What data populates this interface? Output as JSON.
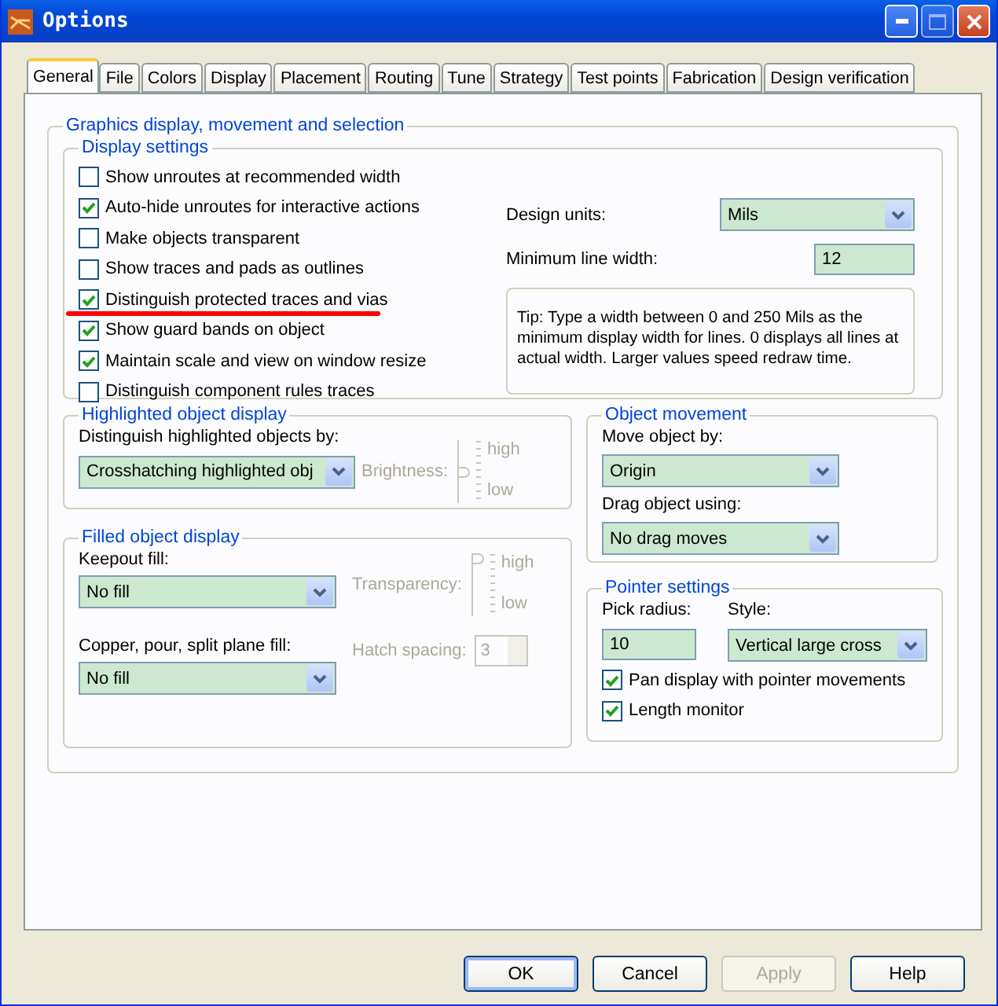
{
  "window": {
    "title": "Options"
  },
  "tabs": [
    {
      "label": "General",
      "selected": true
    },
    {
      "label": "File",
      "selected": false
    },
    {
      "label": "Colors",
      "selected": false
    },
    {
      "label": "Display",
      "selected": false
    },
    {
      "label": "Placement",
      "selected": false
    },
    {
      "label": "Routing",
      "selected": false
    },
    {
      "label": "Tune",
      "selected": false
    },
    {
      "label": "Strategy",
      "selected": false
    },
    {
      "label": "Test points",
      "selected": false
    },
    {
      "label": "Fabrication",
      "selected": false
    },
    {
      "label": "Design verification",
      "selected": false
    }
  ],
  "group": {
    "title": "Graphics display, movement and selection"
  },
  "display_settings": {
    "title": "Display settings",
    "checkboxes": [
      {
        "label": "Show unroutes at recommended width",
        "checked": false
      },
      {
        "label": "Auto-hide unroutes for interactive actions",
        "checked": true
      },
      {
        "label": "Make objects transparent",
        "checked": false
      },
      {
        "label": "Show traces and pads as outlines",
        "checked": false
      },
      {
        "label": "Distinguish protected traces and vias",
        "checked": true,
        "underlined": true
      },
      {
        "label": "Show guard bands on object",
        "checked": true
      },
      {
        "label": "Maintain scale and view on window resize",
        "checked": true
      },
      {
        "label": "Distinguish component rules traces",
        "checked": false
      }
    ],
    "design_units": {
      "label": "Design units:",
      "value": "Mils"
    },
    "min_line_width": {
      "label": "Minimum line width:",
      "value": "12"
    },
    "tip": "Tip: Type a width between 0 and 250 Mils as the minimum display width for lines. 0 displays all lines at actual width. Larger values speed redraw time."
  },
  "highlighted": {
    "title": "Highlighted object display",
    "select": {
      "label": "Distinguish highlighted objects by:",
      "value": "Crosshatching highlighted obj"
    },
    "brightness": {
      "label": "Brightness:",
      "high": "high",
      "low": "low",
      "level": 0.5,
      "disabled": true
    }
  },
  "filled": {
    "title": "Filled object display",
    "keepout": {
      "label": "Keepout fill:",
      "value": "No fill"
    },
    "copper": {
      "label": "Copper, pour, split plane fill:",
      "value": "No fill"
    },
    "transparency": {
      "label": "Transparency:",
      "high": "high",
      "low": "low",
      "level": 1,
      "disabled": true
    },
    "hatch": {
      "label": "Hatch spacing:",
      "value": "3",
      "disabled": true
    }
  },
  "object_movement": {
    "title": "Object movement",
    "move": {
      "label": "Move object by:",
      "value": "Origin"
    },
    "drag": {
      "label": "Drag object using:",
      "value": "No drag moves"
    }
  },
  "pointer": {
    "title": "Pointer settings",
    "pick_radius": {
      "label": "Pick radius:",
      "value": "10"
    },
    "style": {
      "label": "Style:",
      "value": "Vertical large cross"
    },
    "checkboxes": [
      {
        "label": "Pan display with pointer movements",
        "checked": true
      },
      {
        "label": "Length monitor",
        "checked": true
      }
    ]
  },
  "buttons": [
    {
      "label": "OK",
      "default": true,
      "disabled": false
    },
    {
      "label": "Cancel",
      "default": false,
      "disabled": false
    },
    {
      "label": "Apply",
      "default": false,
      "disabled": true
    },
    {
      "label": "Help",
      "default": false,
      "disabled": false
    }
  ]
}
